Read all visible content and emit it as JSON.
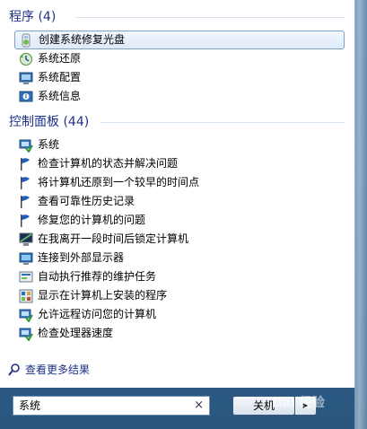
{
  "programs": {
    "header": "程序 (4)",
    "items": [
      {
        "label": "创建系统修复光盘",
        "icon": "repair-disc-icon",
        "selected": true
      },
      {
        "label": "系统还原",
        "icon": "system-restore-icon"
      },
      {
        "label": "系统配置",
        "icon": "system-config-icon"
      },
      {
        "label": "系统信息",
        "icon": "system-info-icon"
      }
    ]
  },
  "control_panel": {
    "header": "控制面板 (44)",
    "items": [
      {
        "label": "系统",
        "icon": "computer-check-icon"
      },
      {
        "label": "检查计算机的状态并解决问题",
        "icon": "flag-icon"
      },
      {
        "label": "将计算机还原到一个较早的时间点",
        "icon": "flag-icon"
      },
      {
        "label": "查看可靠性历史记录",
        "icon": "flag-icon"
      },
      {
        "label": "修复您的计算机的问题",
        "icon": "flag-icon"
      },
      {
        "label": "在我离开一段时间后锁定计算机",
        "icon": "monitor-icon"
      },
      {
        "label": "连接到外部显示器",
        "icon": "display-icon"
      },
      {
        "label": "自动执行推荐的维护任务",
        "icon": "maintenance-icon"
      },
      {
        "label": "显示在计算机上安装的程序",
        "icon": "programs-icon"
      },
      {
        "label": "允许远程访问您的计算机",
        "icon": "computer-check-icon"
      },
      {
        "label": "检查处理器速度",
        "icon": "computer-check-icon"
      }
    ]
  },
  "see_more": "查看更多结果",
  "search": {
    "value": "系统",
    "clear": "×"
  },
  "shutdown": {
    "label": "关机",
    "arrow": "▸"
  },
  "watermark": "Bai 经验"
}
